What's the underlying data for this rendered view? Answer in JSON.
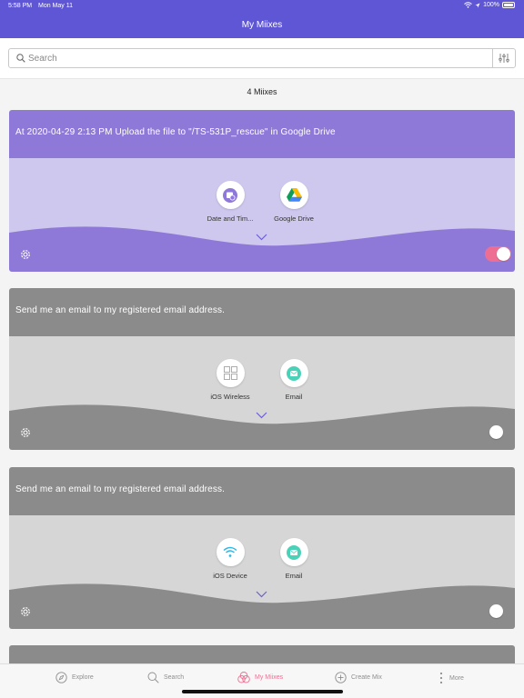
{
  "status": {
    "time": "5:58 PM",
    "date": "Mon May 11",
    "battery": "100%"
  },
  "nav": {
    "title": "My Miixes"
  },
  "search": {
    "placeholder": "Search"
  },
  "count_label": "4 Miixes",
  "cards": [
    {
      "title": "At  2020-04-29  2:13 PM Upload the file to \"/TS-531P_rescue\" in Google Drive",
      "services": [
        "Date and Tim...",
        "Google Drive"
      ],
      "enabled": true
    },
    {
      "title": "Send me an email to my registered email address.",
      "services": [
        "iOS Wireless",
        "Email"
      ],
      "enabled": false
    },
    {
      "title": "Send me an email to my registered email address.",
      "services": [
        "iOS Device",
        "Email"
      ],
      "enabled": false
    }
  ],
  "tabs": [
    {
      "label": "Explore",
      "icon": "compass-icon"
    },
    {
      "label": "Search",
      "icon": "search-icon"
    },
    {
      "label": "My Miixes",
      "icon": "my-miixes-icon",
      "active": true
    },
    {
      "label": "Create Mix",
      "icon": "plus-circle-icon"
    },
    {
      "label": "More",
      "icon": "more-vertical-icon"
    }
  ],
  "colors": {
    "brand": "#5f56d5",
    "accent": "#ee6e93",
    "card_active": "#8f79d8",
    "card_inactive": "#8b8b8b"
  }
}
